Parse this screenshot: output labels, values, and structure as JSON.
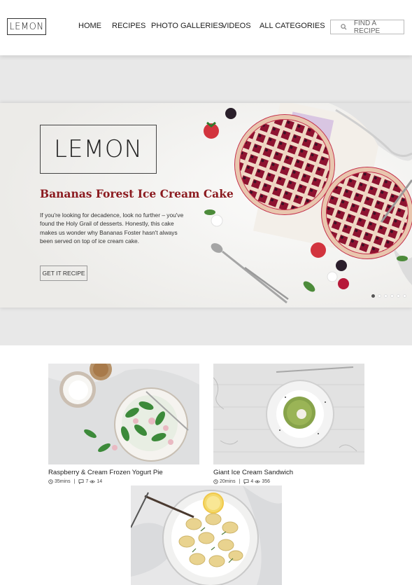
{
  "header": {
    "logo": "LEMON",
    "nav": [
      {
        "label": "HOME"
      },
      {
        "label": "RECIPES"
      },
      {
        "label": "PHOTO GALLERIES"
      },
      {
        "label": "VIDEOS"
      },
      {
        "label": "ALL CATEGORIES"
      }
    ],
    "search_placeholder": "FIND A RECIPE"
  },
  "hero": {
    "logo": "LEMON",
    "title": "Bananas Forest Ice Cream Cake",
    "description": "If you're looking for decadence, look no further – you've found the Holy Grail of desserts. Honestly, this cake makes us wonder why Bananas Foster hasn't always been served on top of ice cream cake.",
    "button": "GET IT RECIPE",
    "slides": 6,
    "active_slide": 1
  },
  "cards": [
    {
      "title": "Raspberry & Cream Frozen Yogurt Pie",
      "time": "35mins",
      "comments": "7",
      "views": "14"
    },
    {
      "title": "Giant Ice Cream Sandwich",
      "time": "20mins",
      "comments": "4",
      "views": "356"
    },
    {
      "title": "",
      "time": "",
      "comments": "",
      "views": ""
    }
  ],
  "colors": {
    "accent": "#8b1a1f",
    "band": "#e8e8e8"
  }
}
